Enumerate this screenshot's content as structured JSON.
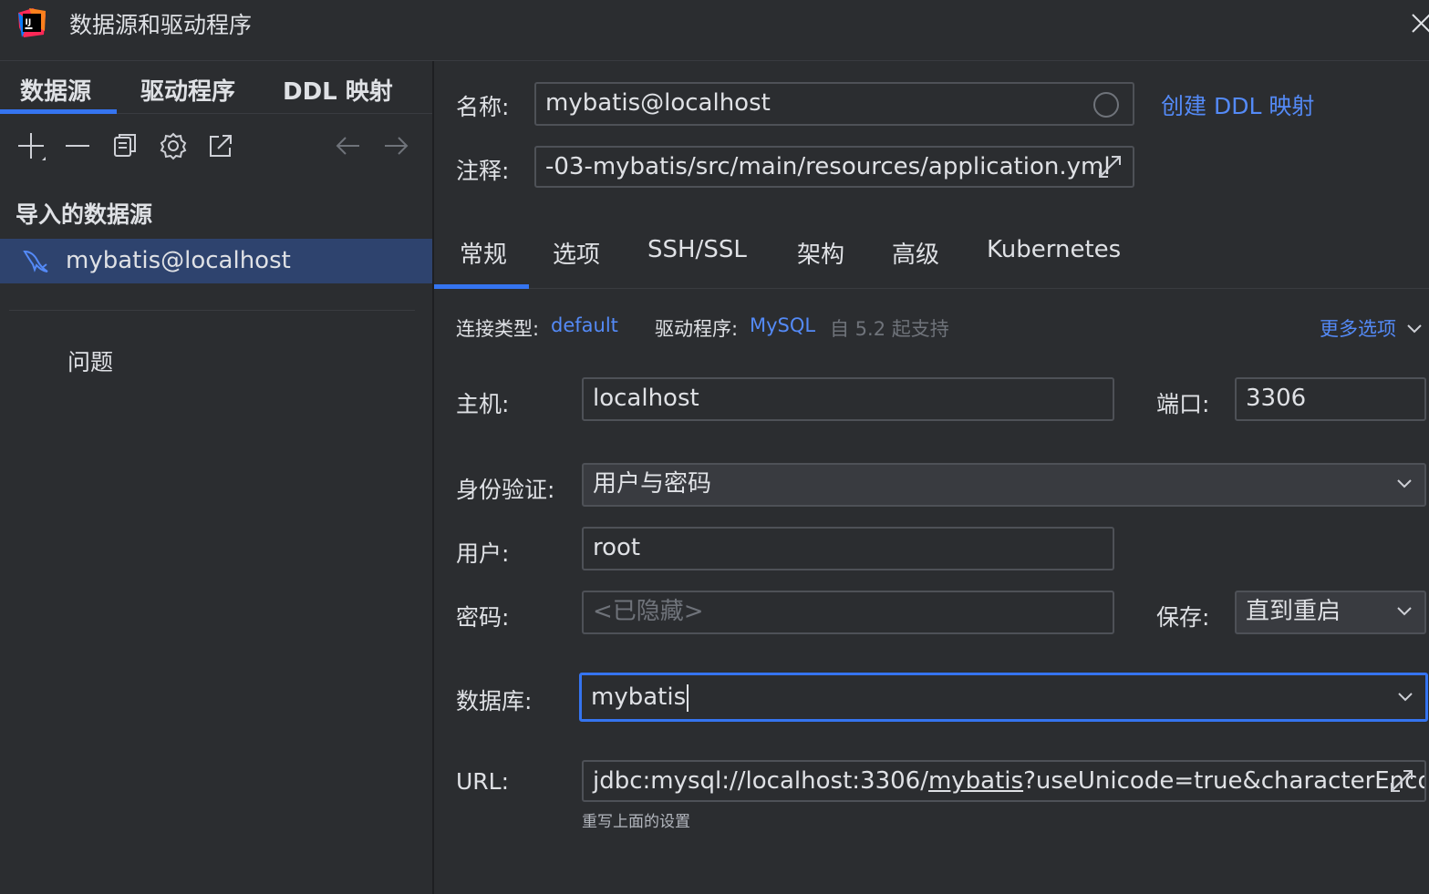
{
  "window": {
    "title": "数据源和驱动程序"
  },
  "left": {
    "tabs": [
      {
        "label": "数据源"
      },
      {
        "label": "驱动程序"
      },
      {
        "label": "DDL 映射"
      }
    ],
    "imported_header": "导入的数据源",
    "datasource": "mybatis@localhost",
    "problems": "问题"
  },
  "form": {
    "name_label": "名称:",
    "name_value": "mybatis@localhost",
    "create_ddl_link": "创建 DDL 映射",
    "comment_label": "注释:",
    "comment_value": "-03-mybatis/src/main/resources/application.yml",
    "tabs": [
      {
        "label": "常规"
      },
      {
        "label": "选项"
      },
      {
        "label": "SSH/SSL"
      },
      {
        "label": "架构"
      },
      {
        "label": "高级"
      },
      {
        "label": "Kubernetes"
      }
    ],
    "conn_type_label": "连接类型:",
    "conn_type_value": "default",
    "driver_label": "驱动程序:",
    "driver_value": "MySQL",
    "driver_note": "自 5.2 起支持",
    "more_options": "更多选项",
    "host_label": "主机:",
    "host_value": "localhost",
    "port_label": "端口:",
    "port_value": "3306",
    "auth_label": "身份验证:",
    "auth_value": "用户与密码",
    "user_label": "用户:",
    "user_value": "root",
    "password_label": "密码:",
    "password_placeholder": "<已隐藏>",
    "save_label": "保存:",
    "save_value": "直到重启",
    "database_label": "数据库:",
    "database_value": "mybatis",
    "url_label": "URL:",
    "url_prefix": "jdbc:mysql://localhost:3306/",
    "url_db": "mybatis",
    "url_suffix": "?useUnicode=true&characterEnco",
    "url_hint": "重写上面的设置"
  },
  "colors": {
    "background": "#2b2d30",
    "accent": "#3574f0",
    "link": "#548af7",
    "selection": "#2e436e"
  }
}
